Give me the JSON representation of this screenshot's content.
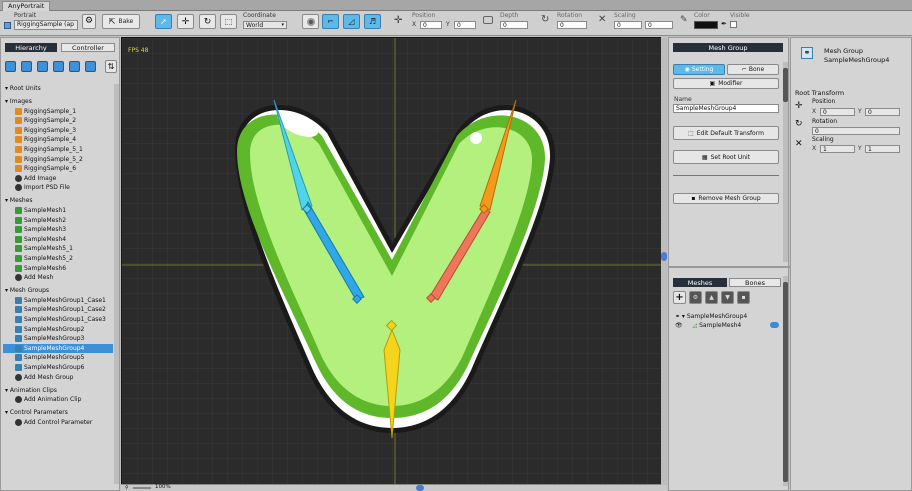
{
  "title_tab": "AnyPortrait",
  "toolbar": {
    "portrait_label": "Portrait",
    "portrait_value": "RiggingSample (ap",
    "bake_label": "Bake",
    "coordinate_label": "Coordinate",
    "coordinate_value": "World",
    "position_label": "Position",
    "position_x": "0",
    "position_y": "0",
    "depth_label": "Depth",
    "depth_value": "0",
    "rotation_label": "Rotation",
    "rotation_value": "0",
    "scaling_label": "Scaling",
    "scaling_x": "0",
    "scaling_y": "0",
    "color_label": "Color",
    "visible_label": "Visible",
    "x_label": "X",
    "y_label": "Y"
  },
  "left_panel": {
    "tab_hierarchy": "Hierarchy",
    "tab_controller": "Controller",
    "rows": [
      {
        "text": "Root Units",
        "kind": "section"
      },
      {
        "text": "Images",
        "kind": "section"
      },
      {
        "text": "RiggingSample_1",
        "kind": "image"
      },
      {
        "text": "RiggingSample_2",
        "kind": "image"
      },
      {
        "text": "RiggingSample_3",
        "kind": "image"
      },
      {
        "text": "RiggingSample_4",
        "kind": "image"
      },
      {
        "text": "RiggingSample_5_1",
        "kind": "image"
      },
      {
        "text": "RiggingSample_5_2",
        "kind": "image"
      },
      {
        "text": "RiggingSample_6",
        "kind": "image"
      },
      {
        "text": "Add Image",
        "kind": "add"
      },
      {
        "text": "Import PSD File",
        "kind": "add"
      },
      {
        "text": "Meshes",
        "kind": "section"
      },
      {
        "text": "SampleMesh1",
        "kind": "mesh"
      },
      {
        "text": "SampleMesh2",
        "kind": "mesh"
      },
      {
        "text": "SampleMesh3",
        "kind": "mesh"
      },
      {
        "text": "SampleMesh4",
        "kind": "mesh"
      },
      {
        "text": "SampleMesh5_1",
        "kind": "mesh"
      },
      {
        "text": "SampleMesh5_2",
        "kind": "mesh"
      },
      {
        "text": "SampleMesh6",
        "kind": "mesh"
      },
      {
        "text": "Add Mesh",
        "kind": "add"
      },
      {
        "text": "Mesh Groups",
        "kind": "section"
      },
      {
        "text": "SampleMeshGroup1_Case1",
        "kind": "group"
      },
      {
        "text": "SampleMeshGroup1_Case2",
        "kind": "group"
      },
      {
        "text": "SampleMeshGroup1_Case3",
        "kind": "group"
      },
      {
        "text": "SampleMeshGroup2",
        "kind": "group"
      },
      {
        "text": "SampleMeshGroup3",
        "kind": "group"
      },
      {
        "text": "SampleMeshGroup4",
        "kind": "group",
        "selected": true
      },
      {
        "text": "SampleMeshGroup5",
        "kind": "group"
      },
      {
        "text": "SampleMeshGroup6",
        "kind": "group"
      },
      {
        "text": "Add Mesh Group",
        "kind": "add"
      },
      {
        "text": "Animation Clips",
        "kind": "section"
      },
      {
        "text": "Add Animation Clip",
        "kind": "add"
      },
      {
        "text": "Control Parameters",
        "kind": "section"
      },
      {
        "text": "Add Control Parameter",
        "kind": "add"
      }
    ]
  },
  "viewport": {
    "fps": "FPS 48",
    "zoom": "100%"
  },
  "mesh_group_panel": {
    "header": "Mesh Group",
    "tab_setting": "Setting",
    "tab_bone": "Bone",
    "modifier_button": "Modifier",
    "name_label": "Name",
    "name_value": "SampleMeshGroup4",
    "edit_default_transform": "Edit Default Transform",
    "set_root_unit": "Set Root Unit",
    "remove_mesh_group": "Remove Mesh Group",
    "tab_meshes": "Meshes",
    "tab_bones": "Bones",
    "tree_group": "SampleMeshGroup4",
    "tree_mesh": "SampleMesh4"
  },
  "inspector": {
    "title": "Mesh Group",
    "subtitle": "SampleMeshGroup4",
    "root_transform": "Root Transform",
    "position_label": "Position",
    "pos_x": "0",
    "pos_y": "0",
    "rotation_label": "Rotation",
    "rotation_value": "0",
    "scaling_label": "Scaling",
    "scale_x": "1",
    "scale_y": "1",
    "x_label": "X",
    "y_label": "Y"
  },
  "colors": {
    "accent": "#5eb8e8",
    "selection": "#3d8fd8",
    "viewport_bg": "#2b2b2b",
    "mesh_fill": "#b4f07e",
    "mesh_rim": "#5fb82a"
  }
}
